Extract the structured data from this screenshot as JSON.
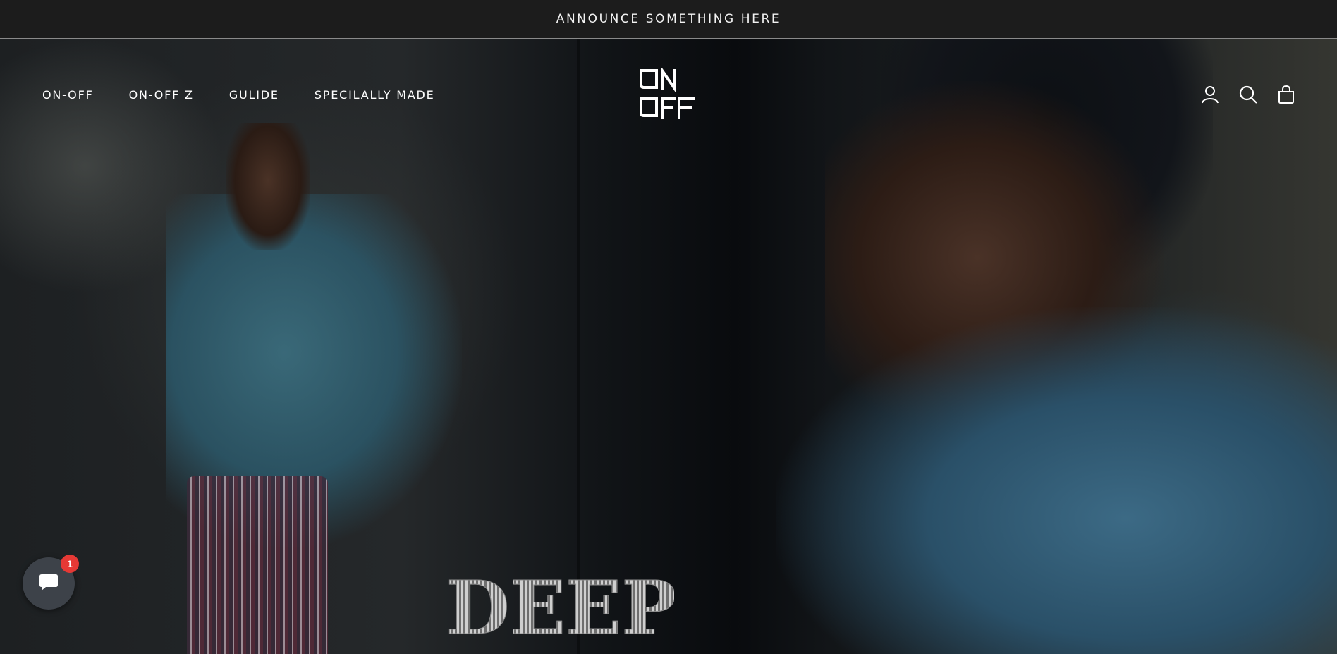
{
  "announcement": {
    "text": "ANNOUNCE SOMETHING HERE"
  },
  "header": {
    "logo_text": "ON OFF",
    "nav": [
      {
        "label": "ON-OFF"
      },
      {
        "label": "ON-OFF Z"
      },
      {
        "label": "GULIDE"
      },
      {
        "label": "SPECILALLY MADE"
      }
    ],
    "icons": [
      "account-icon",
      "search-icon",
      "shopping-bag-icon"
    ]
  },
  "hero": {
    "headline": "DEEP"
  },
  "chat_widget": {
    "icon": "chat-icon",
    "badge_count": "1",
    "colors": {
      "button": "#3d4249",
      "badge": "#e53935"
    }
  },
  "colors": {
    "announcement_bar": "#1c1c1c",
    "text": "#ffffff"
  }
}
